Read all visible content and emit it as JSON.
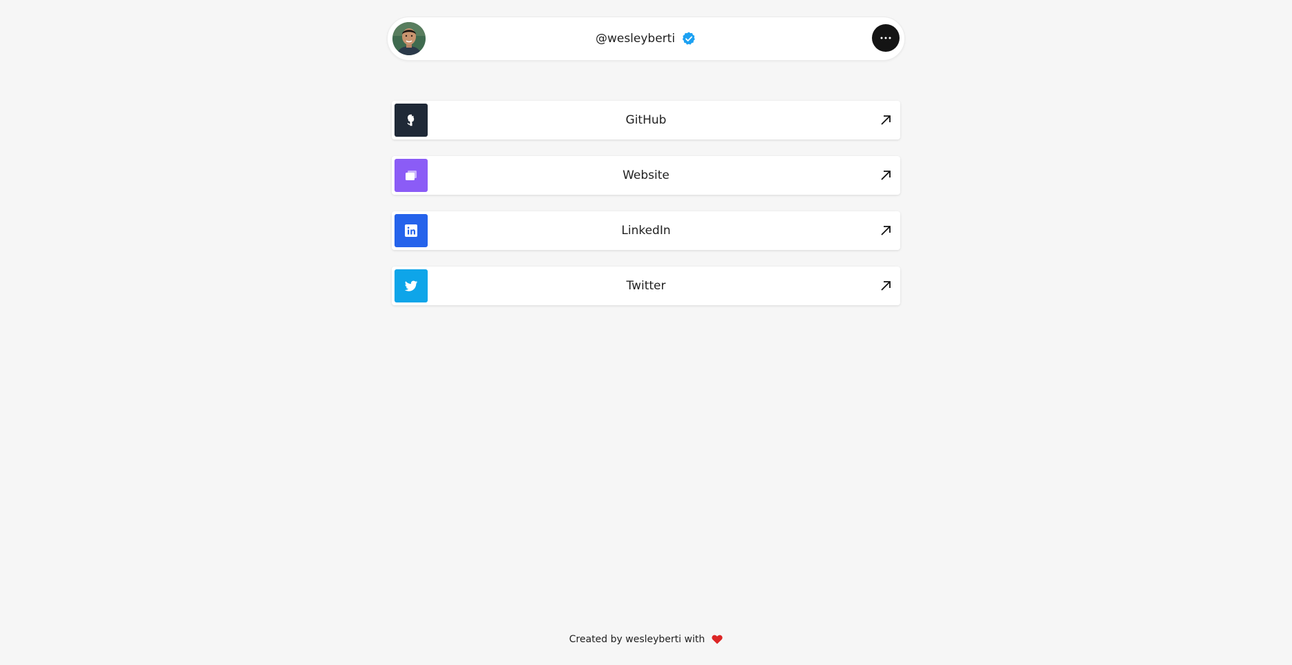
{
  "profile": {
    "handle": "@wesleyberti",
    "avatar_icon": "user-avatar-photo",
    "verified_icon": "verified-badge-icon",
    "verified_color": "#1da1f2",
    "menu_icon": "more-horizontal-icon"
  },
  "links": [
    {
      "label": "GitHub",
      "icon": "github-icon",
      "color": "#1f2937"
    },
    {
      "label": "Website",
      "icon": "browser-window-icon",
      "color": "#8b5cf6"
    },
    {
      "label": "LinkedIn",
      "icon": "linkedin-icon",
      "color": "#2563eb"
    },
    {
      "label": "Twitter",
      "icon": "twitter-icon",
      "color": "#0ea5e9"
    }
  ],
  "link_arrow_icon": "arrow-up-right-icon",
  "footer": {
    "text": "Created by wesleyberti with",
    "heart_icon": "heart-icon",
    "heart_color": "#dc2626"
  }
}
